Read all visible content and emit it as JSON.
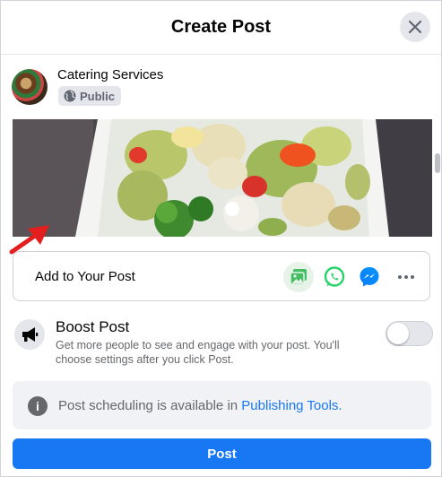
{
  "header": {
    "title": "Create Post",
    "close_icon": "close-icon"
  },
  "author": {
    "name": "Catering Services",
    "privacy_label": "Public",
    "privacy_icon": "globe-icon"
  },
  "media": {
    "annotation_icon": "red-arrow-icon"
  },
  "add_to_post": {
    "label": "Add to Your Post",
    "icons": [
      "photo-video-icon",
      "whatsapp-icon",
      "messenger-icon",
      "more-icon"
    ]
  },
  "boost": {
    "title": "Boost Post",
    "description": "Get more people to see and engage with your post. You'll choose settings after you click Post.",
    "enabled": false
  },
  "scheduling": {
    "text": "Post scheduling is available in ",
    "link": "Publishing Tools."
  },
  "post_button": {
    "label": "Post"
  },
  "colors": {
    "primary": "#1877f2",
    "whatsapp": "#25d366",
    "photo_bg": "#e7f3e8",
    "photo_icon": "#45bd62",
    "arrow": "#e41e1e"
  }
}
